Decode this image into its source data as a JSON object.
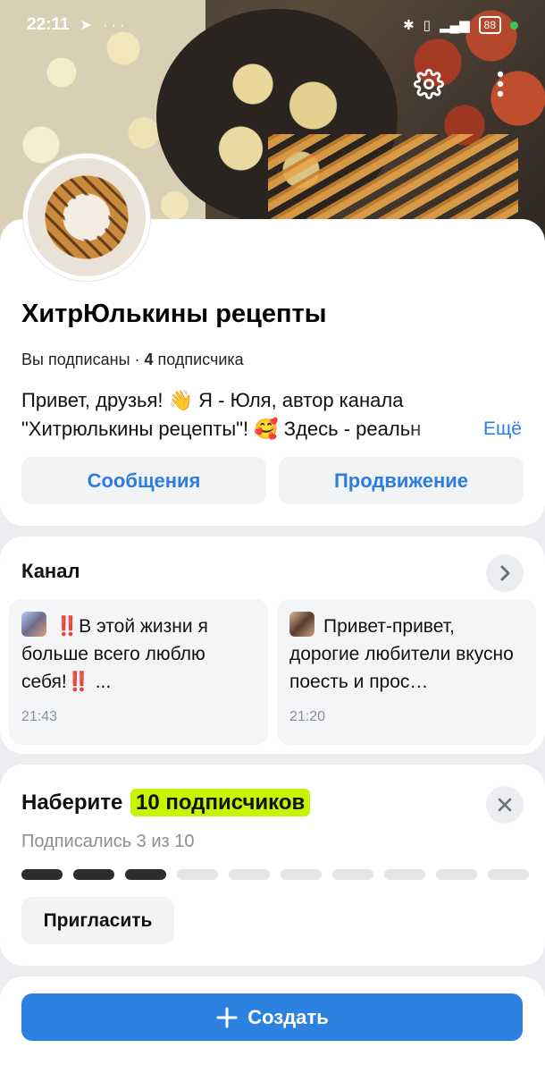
{
  "status_bar": {
    "time": "22:11",
    "left_icons": [
      "telegram-icon",
      "more-dots"
    ],
    "battery": "88"
  },
  "header": {
    "settings_icon": "gear-icon",
    "menu_icon": "kebab-icon"
  },
  "profile": {
    "name": "ХитрЮлькины рецепты",
    "subscribed_label": "Вы подписаны · ",
    "subscriber_count": "4",
    "subscriber_word": " подписчика",
    "description_line1": "Привет, друзья! 👋 Я - Юля, автор канала",
    "description_line2": "\"Хитрюлькины рецепты\"! 🥰 Здесь - реальн",
    "more_label": "Ещё",
    "messages_button": "Сообщения",
    "promotion_button": "Продвижение"
  },
  "channel": {
    "title": "Канал",
    "posts": [
      {
        "bang": "‼️",
        "text": "В этой жизни я больше всего люблю себя!",
        "bang_end": "‼️",
        "ellipsis": " ...",
        "time": "21:43"
      },
      {
        "text": "Привет-привет, дорогие любители вкусно поесть и прос…",
        "time": "21:20"
      }
    ]
  },
  "goal": {
    "title_prefix": "Наберите ",
    "title_highlight": "10 подписчиков",
    "subtitle": "Подписались 3 из 10",
    "progress_done": 3,
    "progress_total": 10,
    "invite_button": "Пригласить"
  },
  "create": {
    "label": "Создать"
  },
  "colors": {
    "accent": "#2d81e0",
    "link": "#2b7de1",
    "highlight": "#c7f500"
  }
}
